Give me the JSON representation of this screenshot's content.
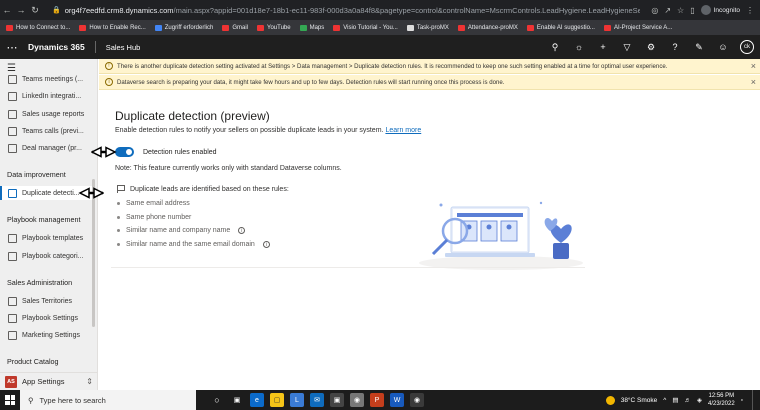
{
  "browser": {
    "url_main": "org4f7eedfd.crm8.dynamics.com",
    "url_rest": "/main.aspx?appid=001d18e7-18b1-ec11-983f-000d3a0a84f8&pagetype=control&controlName=MscrmControls.LeadHygiene.LeadHygieneSettingsCont...",
    "profile_label": "Incognito",
    "bookmarks": [
      {
        "label": "How to Connect to...",
        "color": "#e33"
      },
      {
        "label": "How to Enable Rec...",
        "color": "#e33"
      },
      {
        "label": "Zugriff erforderlich",
        "color": "#4285f4"
      },
      {
        "label": "Gmail",
        "color": "#e33"
      },
      {
        "label": "YouTube",
        "color": "#e33"
      },
      {
        "label": "Maps",
        "color": "#34a853"
      },
      {
        "label": "Visio Tutorial - You...",
        "color": "#e33"
      },
      {
        "label": "Task-proMX",
        "color": "#ddd"
      },
      {
        "label": "Attendance-proMX",
        "color": "#e33"
      },
      {
        "label": "Enable AI suggestio...",
        "color": "#e33"
      },
      {
        "label": "AI-Project Service A...",
        "color": "#e33"
      }
    ]
  },
  "header": {
    "app_name": "Dynamics 365",
    "hub_name": "Sales Hub",
    "avatar_initials": "ck"
  },
  "notifications": [
    "There is another duplicate detection setting activated at Settings > Data management > Duplicate detection rules. It is recommended to keep one such setting enabled at a time for optimal user experience.",
    "Dataverse search is preparing your data, it might take few hours and up to few days. Detection rules will start running once this process is done."
  ],
  "sidebar": {
    "items_top": [
      {
        "label": "Teams meetings (...",
        "y": 0
      },
      {
        "label": "LinkedIn integrati...",
        "y": 0
      },
      {
        "label": "Sales usage reports",
        "y": 0
      },
      {
        "label": "Teams calls (previ...",
        "y": 0
      },
      {
        "label": "Deal manager (pr...",
        "y": 0
      }
    ],
    "group_data_improvement": "Data improvement",
    "item_duplicate": "Duplicate detecti...",
    "group_playbook": "Playbook management",
    "item_playbook_templates": "Playbook templates",
    "item_playbook_categories": "Playbook categori...",
    "group_sales_admin": "Sales Administration",
    "item_sales_territories": "Sales Territories",
    "item_playbook_settings": "Playbook Settings",
    "item_marketing_settings": "Marketing Settings",
    "group_product_catalog": "Product Catalog",
    "area_badge": "AS",
    "area_label": "App Settings"
  },
  "main": {
    "title": "Duplicate detection (preview)",
    "description": "Enable detection rules to notify your sellers on possible duplicate leads in your system.",
    "learn_more": "Learn more",
    "toggle_label": "Detection rules enabled",
    "toggle_on": true,
    "note": "Note: This feature currently works only with standard Dataverse columns.",
    "rules_heading": "Duplicate leads are identified based on these rules:",
    "rules": [
      "Same email address",
      "Same phone number",
      "Similar name and company name",
      "Similar name and the same email domain"
    ]
  },
  "taskbar": {
    "search_placeholder": "Type here to search",
    "weather": "38°C  Smoke",
    "time": "12:56 PM",
    "date": "4/23/2022"
  }
}
